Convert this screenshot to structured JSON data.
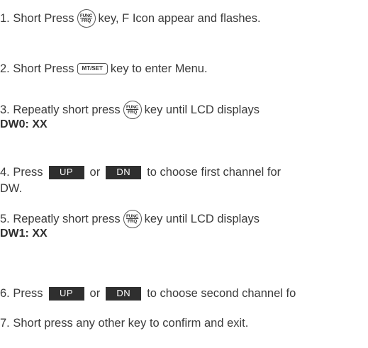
{
  "keys": {
    "func_top": "FUNC",
    "func_bottom": "FRQ",
    "mt_set": "MT/SET",
    "up": "UP",
    "dn": "DN"
  },
  "steps": [
    {
      "pre": "1. Short Press",
      "post": "key, F Icon appear and flashes."
    },
    {
      "pre": "2. Short Press",
      "post": "key to enter Menu."
    },
    {
      "pre": "3. Repeatly short press",
      "post": "key until LCD displays",
      "bold": "DW0: XX"
    },
    {
      "pre": "4. Press",
      "mid": "or",
      "post": "to choose first channel for",
      "cont": "DW."
    },
    {
      "pre": "5. Repeatly short press",
      "post": "key until LCD displays",
      "bold": "DW1: XX"
    },
    {
      "pre": "6. Press",
      "mid": "or",
      "post": "to choose second  channel fo"
    },
    {
      "text": "7. Short press any other key to confirm and exit."
    }
  ]
}
